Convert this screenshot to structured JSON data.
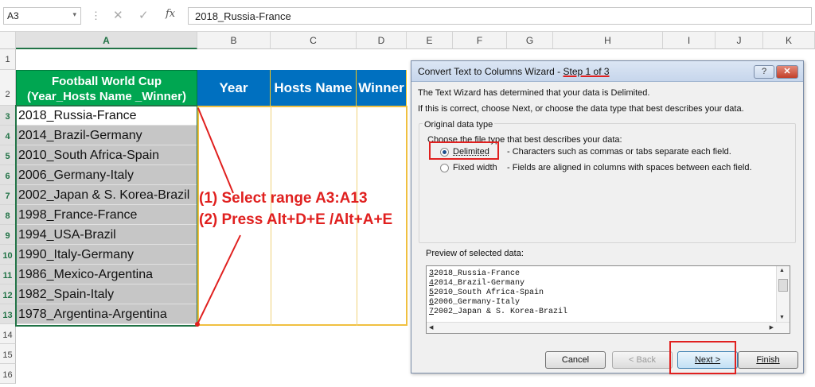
{
  "formula_bar": {
    "name_box": "A3",
    "name_box_arrow": "▾",
    "separator": "⋮",
    "cancel_glyph": "✕",
    "enter_glyph": "✓",
    "fx_glyph": "fx",
    "formula": "2018_Russia-France"
  },
  "columns": [
    "A",
    "B",
    "C",
    "D",
    "E",
    "F",
    "G",
    "H",
    "I",
    "J",
    "K"
  ],
  "rows": [
    "1",
    "2",
    "3",
    "4",
    "5",
    "6",
    "7",
    "8",
    "9",
    "10",
    "11",
    "12",
    "13",
    "14",
    "15",
    "16"
  ],
  "table": {
    "header_a": "Football World Cup (Year_Hosts Name _Winner)",
    "header_b": "Year",
    "header_c": "Hosts Name",
    "header_d": "Winner",
    "values": [
      "2018_Russia-France",
      "2014_Brazil-Germany",
      "2010_South Africa-Spain",
      "2006_Germany-Italy",
      "2002_Japan & S. Korea-Brazil",
      "1998_France-France",
      "1994_USA-Brazil",
      "1990_Italy-Germany",
      "1986_Mexico-Argentina",
      "1982_Spain-Italy",
      "1978_Argentina-Argentina"
    ]
  },
  "annotations": {
    "step1": "(1) Select range A3:A13",
    "step2": "(2) Press Alt+D+E /Alt+A+E"
  },
  "dialog": {
    "title_prefix": "Convert Text to Columns Wizard - ",
    "title_step": "Step 1 of 3",
    "help_label": "?",
    "close_label": "✕",
    "intro_line1": "The Text Wizard has determined that your data is Delimited.",
    "intro_line2": "If this is correct, choose Next, or choose the data type that best describes your data.",
    "group_label": "Original data type",
    "choose_label": "Choose the file type that best describes your data:",
    "option_delimited": "Delimited",
    "option_delimited_desc": "- Characters such as commas or tabs separate each field.",
    "option_fixed": "Fixed width",
    "option_fixed_desc": "- Fields are aligned in columns with spaces between each field.",
    "preview_label": "Preview of selected data:",
    "preview_rows": [
      {
        "num": "3",
        "text": "2018_Russia-France"
      },
      {
        "num": "4",
        "text": "2014_Brazil-Germany"
      },
      {
        "num": "5",
        "text": "2010_South Africa-Spain"
      },
      {
        "num": "6",
        "text": "2006_Germany-Italy"
      },
      {
        "num": "7",
        "text": "2002_Japan & S. Korea-Brazil"
      }
    ],
    "cancel_btn": "Cancel",
    "back_btn": "< Back",
    "next_btn": "Next >",
    "finish_btn": "Finish"
  },
  "colors": {
    "header_green": "#00a651",
    "header_blue": "#0070c0",
    "highlight_red": "#e0201f",
    "outline_yellow": "#f0c040"
  }
}
